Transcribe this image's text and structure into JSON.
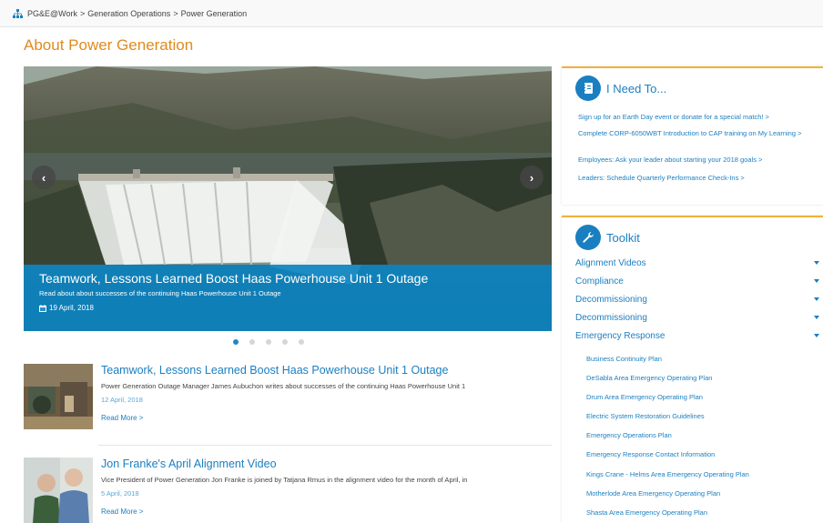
{
  "breadcrumb": {
    "items": [
      "PG&E@Work",
      "Generation Operations",
      "Power Generation"
    ],
    "separator": ">"
  },
  "page": {
    "title": "About Power Generation"
  },
  "carousel": {
    "title": "Teamwork, Lessons Learned Boost Haas Powerhouse Unit 1 Outage",
    "description": "Read about about successes of the continuing Haas Powerhouse Unit 1 Outage",
    "date": "19 April, 2018",
    "slide_count": 5,
    "active_slide": 1,
    "prev_icon": "chevron-left-icon",
    "next_icon": "chevron-right-icon"
  },
  "news": [
    {
      "title": "Teamwork, Lessons Learned Boost Haas Powerhouse Unit 1 Outage",
      "description": "Power Generation Outage Manager James Aubuchon writes about successes of the continuing Haas Powerhouse Unit 1",
      "date": "12 April, 2018",
      "read_more": "Read More  >"
    },
    {
      "title": "Jon Franke's April Alignment Video",
      "description": "Vice President of Power Generation Jon Franke is joined by Tatjana Rmus in the alignment video for the month of April, in",
      "date": "5 April, 2018",
      "read_more": "Read More  >"
    }
  ],
  "ineed": {
    "title": "I Need To...",
    "links": [
      "Sign up for an Earth Day event or donate for a special match! >",
      "Complete CORP-6050WBT Introduction to CAP training on My Learning >",
      "Employees: Ask your leader about starting your 2018 goals >",
      "Leaders: Schedule Quarterly Performance Check-Ins >"
    ]
  },
  "toolkit": {
    "title": "Toolkit",
    "categories": [
      "Alignment Videos",
      "Compliance",
      "Decommissioning",
      "Decommissioning",
      "Emergency Response"
    ],
    "emergency_items": [
      "Business Continuity Plan",
      "DeSabla Area Emergency Operating Plan",
      "Drum Area Emergency Operating Plan",
      "Electric System Restoration Guidelines",
      "Emergency Operations Plan",
      "Emergency Response Contact Information",
      "Kings Crane - Helms Area Emergency Operating Plan",
      "Motherlode Area Emergency Operating Plan",
      "Shasta Area Emergency Operating Plan"
    ]
  },
  "colors": {
    "accent_orange": "#e08a1e",
    "link_blue": "#1a7fc1",
    "caption_blue": "#007dbe",
    "panel_border": "#f0b23a"
  }
}
